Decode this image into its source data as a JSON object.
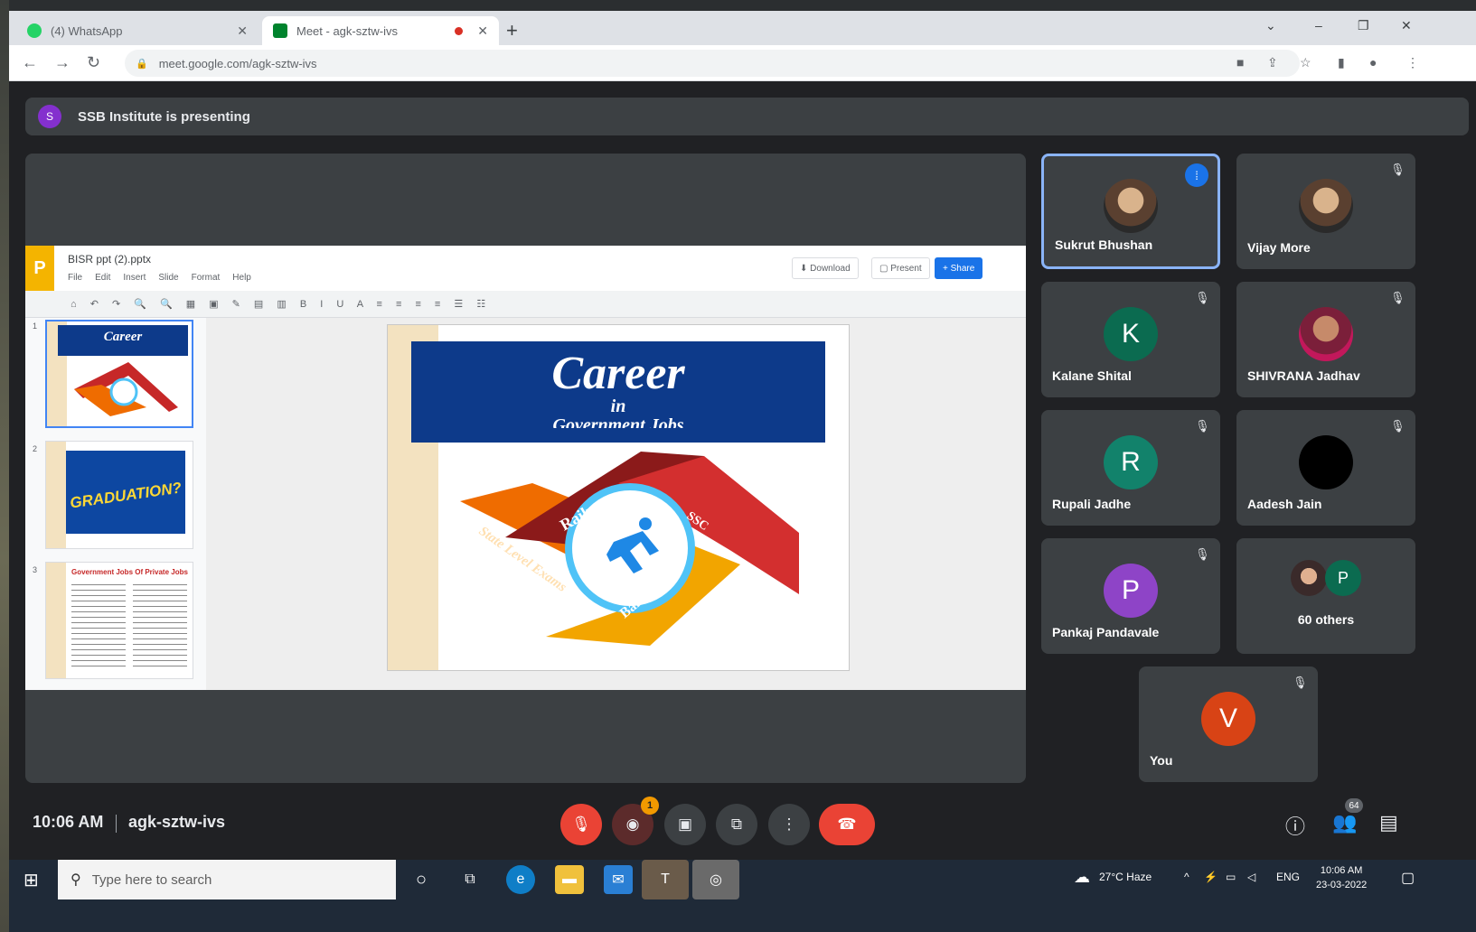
{
  "browser": {
    "tabs": [
      {
        "title": "(4) WhatsApp",
        "close": "✕"
      },
      {
        "title": "Meet - agk-sztw-ivs",
        "close": "✕"
      }
    ],
    "new_tab": "+",
    "url": "meet.google.com/agk-sztw-ivs",
    "window_controls": {
      "minimize": "–",
      "restore": "❐",
      "close": "✕"
    }
  },
  "presenting_bar": {
    "avatar_letter": "S",
    "text": "SSB Institute is presenting"
  },
  "slides_app": {
    "logo": "P",
    "doc_title": "BISR ppt (2).pptx",
    "menu": [
      "File",
      "Edit",
      "Insert",
      "Slide",
      "Format",
      "Help"
    ],
    "buttons": {
      "download": "⬇ Download",
      "present": "▢ Present",
      "share": "+ Share"
    },
    "format_toolbar": "⌂ ↶ ↷ 🔍 🔍 ▦ ▣ ✎ ▤ ▥ B I U A ≡ ≡ ≡ ≡ ☰ ☷",
    "thumbnails": [
      {
        "num": "1",
        "title": "Career"
      },
      {
        "num": "2",
        "title": "GRADUATION?"
      },
      {
        "num": "3",
        "title": "Government Jobs Of Private Jobs"
      }
    ],
    "slide": {
      "title": "Career",
      "in": "in",
      "subtitle": "Government Jobs",
      "arrows": [
        "Railway",
        "SSC",
        "State Level Exams",
        "Bank"
      ]
    }
  },
  "participants": [
    {
      "name": "Sukrut Bhushan",
      "type": "photo",
      "speaking": true
    },
    {
      "name": "Vijay More",
      "type": "photo",
      "speaking": false
    },
    {
      "name": "Kalane Shital",
      "letter": "K",
      "color": "#0b6b50"
    },
    {
      "name": "SHIVRANA Jadhav",
      "type": "photo",
      "speaking": false
    },
    {
      "name": "Rupali Jadhe",
      "letter": "R",
      "color": "#12826b"
    },
    {
      "name": "Aadesh Jain",
      "type": "black"
    },
    {
      "name": "Pankaj Pandavale",
      "letter": "P",
      "color": "#8e44c7"
    },
    {
      "others_label": "60 others",
      "letter": "P",
      "color": "#0b6b50"
    },
    {
      "name": "You",
      "letter": "V",
      "color": "#d84315"
    }
  ],
  "meeting_bar": {
    "time": "10:06 AM",
    "meeting_code": "agk-sztw-ivs",
    "reactions_badge": "1",
    "participants_count": "64"
  },
  "taskbar": {
    "search_placeholder": "Type here to search",
    "weather": "27°C  Haze",
    "lang": "ENG",
    "time": "10:06 AM",
    "date": "23-03-2022"
  },
  "colors": {
    "meet_bg": "#202124",
    "tile_bg": "#3c4043",
    "red_control": "#ea4335",
    "slide_title_bg": "#0d3a8a"
  }
}
